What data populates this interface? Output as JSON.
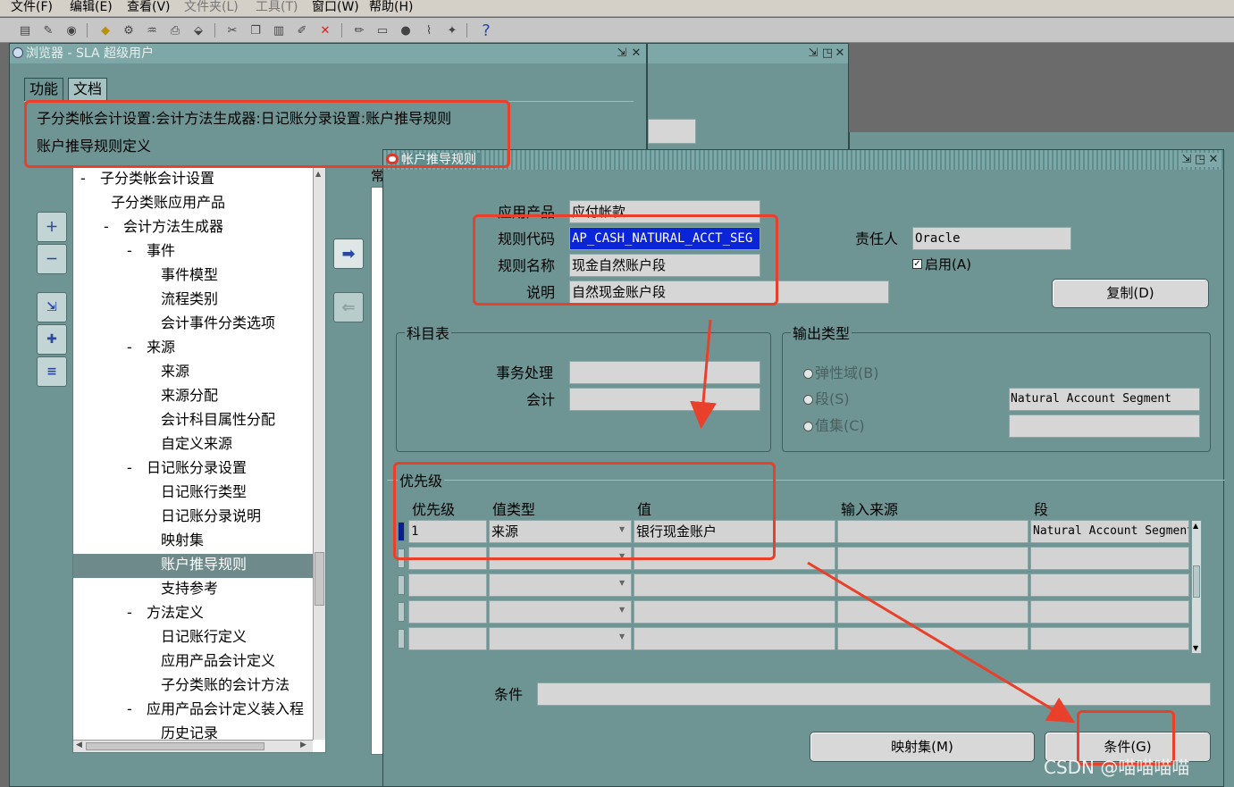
{
  "menu": [
    "文件(F)",
    "编辑(E)",
    "查看(V)",
    "文件夹(L)",
    "工具(T)",
    "窗口(W)",
    "帮助(H)"
  ],
  "navigator": {
    "title": "浏览器 - SLA 超级用户",
    "tabs": [
      "功能",
      "文档"
    ],
    "path_line1": "子分类帐会计设置:会计方法生成器:日记账分录设置:账户推导规则",
    "path_line2": "账户推导规则定义",
    "clipped_label": "常",
    "tree": [
      {
        "label": "子分类帐会计设置",
        "prefix": "-"
      },
      {
        "label": "子分类账应用产品",
        "prefix": ""
      },
      {
        "label": "会计方法生成器",
        "prefix": "-"
      },
      {
        "label": "事件",
        "prefix": "-"
      },
      {
        "label": "事件模型",
        "prefix": ""
      },
      {
        "label": "流程类别",
        "prefix": ""
      },
      {
        "label": "会计事件分类选项",
        "prefix": ""
      },
      {
        "label": "来源",
        "prefix": "-"
      },
      {
        "label": "来源",
        "prefix": ""
      },
      {
        "label": "来源分配",
        "prefix": ""
      },
      {
        "label": "会计科目属性分配",
        "prefix": ""
      },
      {
        "label": "自定义来源",
        "prefix": ""
      },
      {
        "label": "日记账分录设置",
        "prefix": "-"
      },
      {
        "label": "日记账行类型",
        "prefix": ""
      },
      {
        "label": "日记账分录说明",
        "prefix": ""
      },
      {
        "label": "映射集",
        "prefix": ""
      },
      {
        "label": "账户推导规则",
        "prefix": ""
      },
      {
        "label": "支持参考",
        "prefix": ""
      },
      {
        "label": "方法定义",
        "prefix": "-"
      },
      {
        "label": "日记账行定义",
        "prefix": ""
      },
      {
        "label": "应用产品会计定义",
        "prefix": ""
      },
      {
        "label": "子分类账的会计方法",
        "prefix": ""
      },
      {
        "label": "应用产品会计定义装入程",
        "prefix": "-"
      },
      {
        "label": "历史记录",
        "prefix": ""
      }
    ]
  },
  "form": {
    "title": "帐户推导规则",
    "app_label": "应用产品",
    "app_value": "应付帐款",
    "rule_code_label": "规则代码",
    "rule_code_value": "AP_CASH_NATURAL_ACCT_SEG",
    "rule_name_label": "规则名称",
    "rule_name_value": "现金自然账户段",
    "desc_label": "说明",
    "desc_value": "自然现金账户段",
    "owner_label": "责任人",
    "owner_value": "Oracle",
    "enabled_label": "启用(A)",
    "copy_button": "复制(D)",
    "coa_group": "科目表",
    "txn_label": "事务处理",
    "acct_label": "会计",
    "output_group": "输出类型",
    "radio_flex": "弹性域(B)",
    "radio_segment": "段(S)",
    "radio_valueset": "值集(C)",
    "segment_value": "Natural Account Segment",
    "priority_group": "优先级",
    "col_priority": "优先级",
    "col_value_type": "值类型",
    "col_value": "值",
    "col_input_source": "输入来源",
    "col_segment": "段",
    "row1_priority": "1",
    "row1_value_type": "来源",
    "row1_value": "银行现金账户",
    "row1_segment": "Natural Account Segment",
    "condition_label": "条件",
    "mapping_button": "映射集(M)",
    "condition_button": "条件(G)"
  },
  "watermark": "CSDN @喵喵喵喵"
}
